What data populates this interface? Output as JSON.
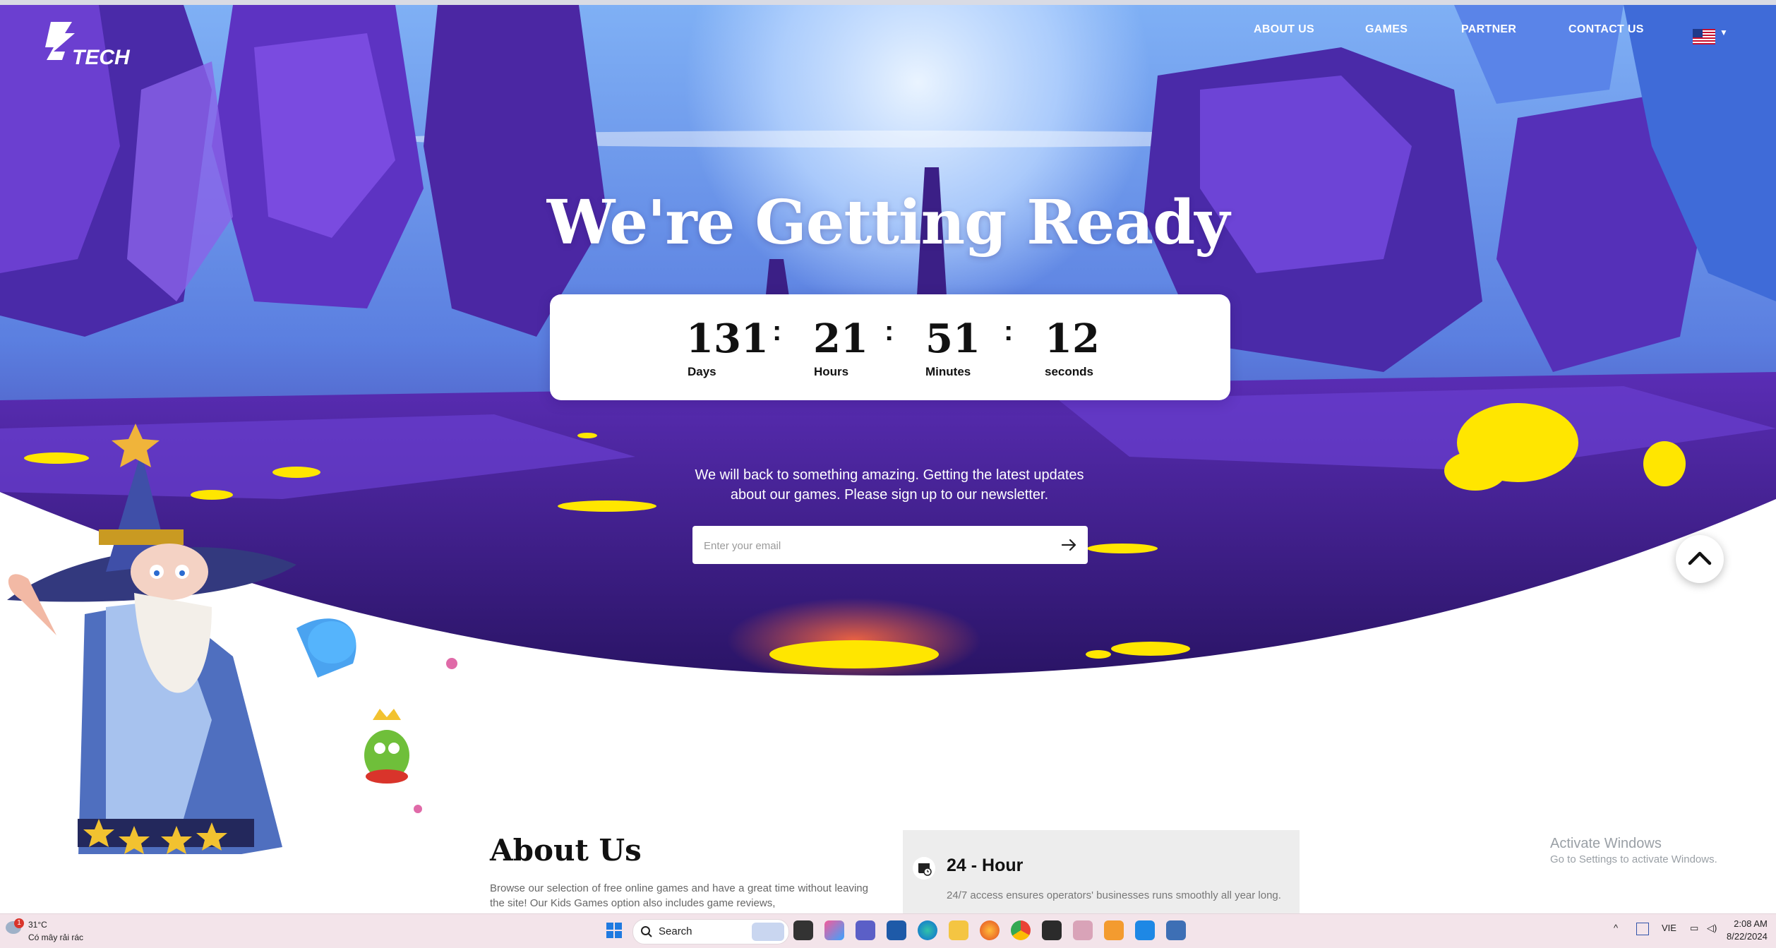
{
  "nav": {
    "about": "ABOUT US",
    "games": "GAMES",
    "partner": "PARTNER",
    "contact": "CONTACT US",
    "language_flag": "us-flag-icon"
  },
  "logo": {
    "text": "TECH"
  },
  "hero": {
    "title": "We're Getting Ready",
    "message": "We will back to something amazing. Getting the latest updates about our games. Please sign up to our newsletter."
  },
  "countdown": {
    "days": "131",
    "days_label": "Days",
    "hours": "21",
    "hours_label": "Hours",
    "minutes": "51",
    "minutes_label": "Minutes",
    "seconds": "12",
    "seconds_label": "seconds"
  },
  "newsletter": {
    "placeholder": "Enter your email",
    "submit_icon": "arrow-right-icon"
  },
  "about": {
    "title": "About Us",
    "text": "Browse our selection of free online games and have a great time without leaving the site! Our Kids Games option also includes game reviews,"
  },
  "feature_card": {
    "title": "24 - Hour",
    "text": "24/7 access ensures operators' businesses runs smoothly all year long."
  },
  "windows_watermark": {
    "line1": "Activate Windows",
    "line2": "Go to Settings to activate Windows."
  },
  "taskbar": {
    "weather_temp": "31°C",
    "weather_desc": "Có mây rải rác",
    "notification_count": "1",
    "search_label": "Search",
    "language": "VIE",
    "time": "2:08 AM",
    "date": "8/22/2024"
  },
  "colors": {
    "hero_sky": "#6ea0f0",
    "hero_purple": "#5b2fb8",
    "glow_yellow": "#ffe600",
    "taskbar": "#f3e4ea"
  }
}
